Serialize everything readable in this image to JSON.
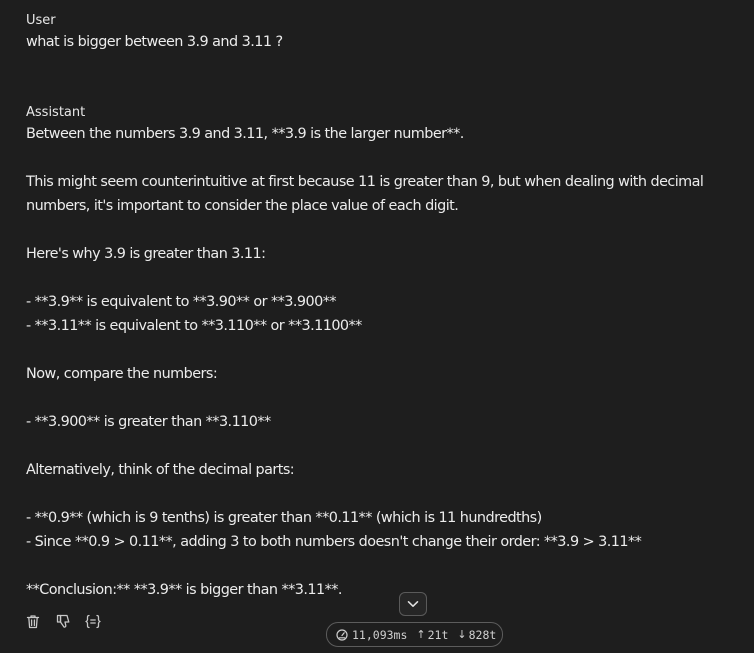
{
  "conversation": {
    "user": {
      "role": "User",
      "lines": [
        "what is bigger between 3.9 and 3.11 ?"
      ]
    },
    "assistant": {
      "role": "Assistant",
      "lines": [
        "Between the numbers 3.9 and 3.11, **3.9 is the larger number**.",
        "",
        "This might seem counterintuitive at first because 11 is greater than 9, but when dealing with decimal",
        "numbers, it's important to consider the place value of each digit.",
        "",
        "Here's why 3.9 is greater than 3.11:",
        "",
        "- **3.9** is equivalent to **3.90** or **3.900**",
        "- **3.11** is equivalent to **3.110** or **3.1100**",
        "",
        "Now, compare the numbers:",
        "",
        "- **3.900** is greater than **3.110**",
        "",
        "Alternatively, think of the decimal parts:",
        "",
        "- **0.9** (which is 9 tenths) is greater than **0.11** (which is 11 hundredths)",
        "- Since **0.9 > 0.11**, adding 3 to both numbers doesn't change their order: **3.9 > 3.11**",
        "",
        "**Conclusion:** **3.9** is bigger than **3.11**."
      ]
    }
  },
  "message_actions": [
    {
      "icon": "trash-icon"
    },
    {
      "icon": "thumbs-down-icon"
    },
    {
      "icon": "variables-icon"
    }
  ],
  "scroll_button": {
    "icon": "chevron-down-icon"
  },
  "stats": {
    "duration": "11,093ms",
    "tokens_in": "21t",
    "tokens_out": "828t",
    "up_arrow": "↑",
    "down_arrow": "↓"
  },
  "colors": {
    "background": "#1e1e1e",
    "text": "#ececec",
    "border": "#5c5c5c"
  }
}
